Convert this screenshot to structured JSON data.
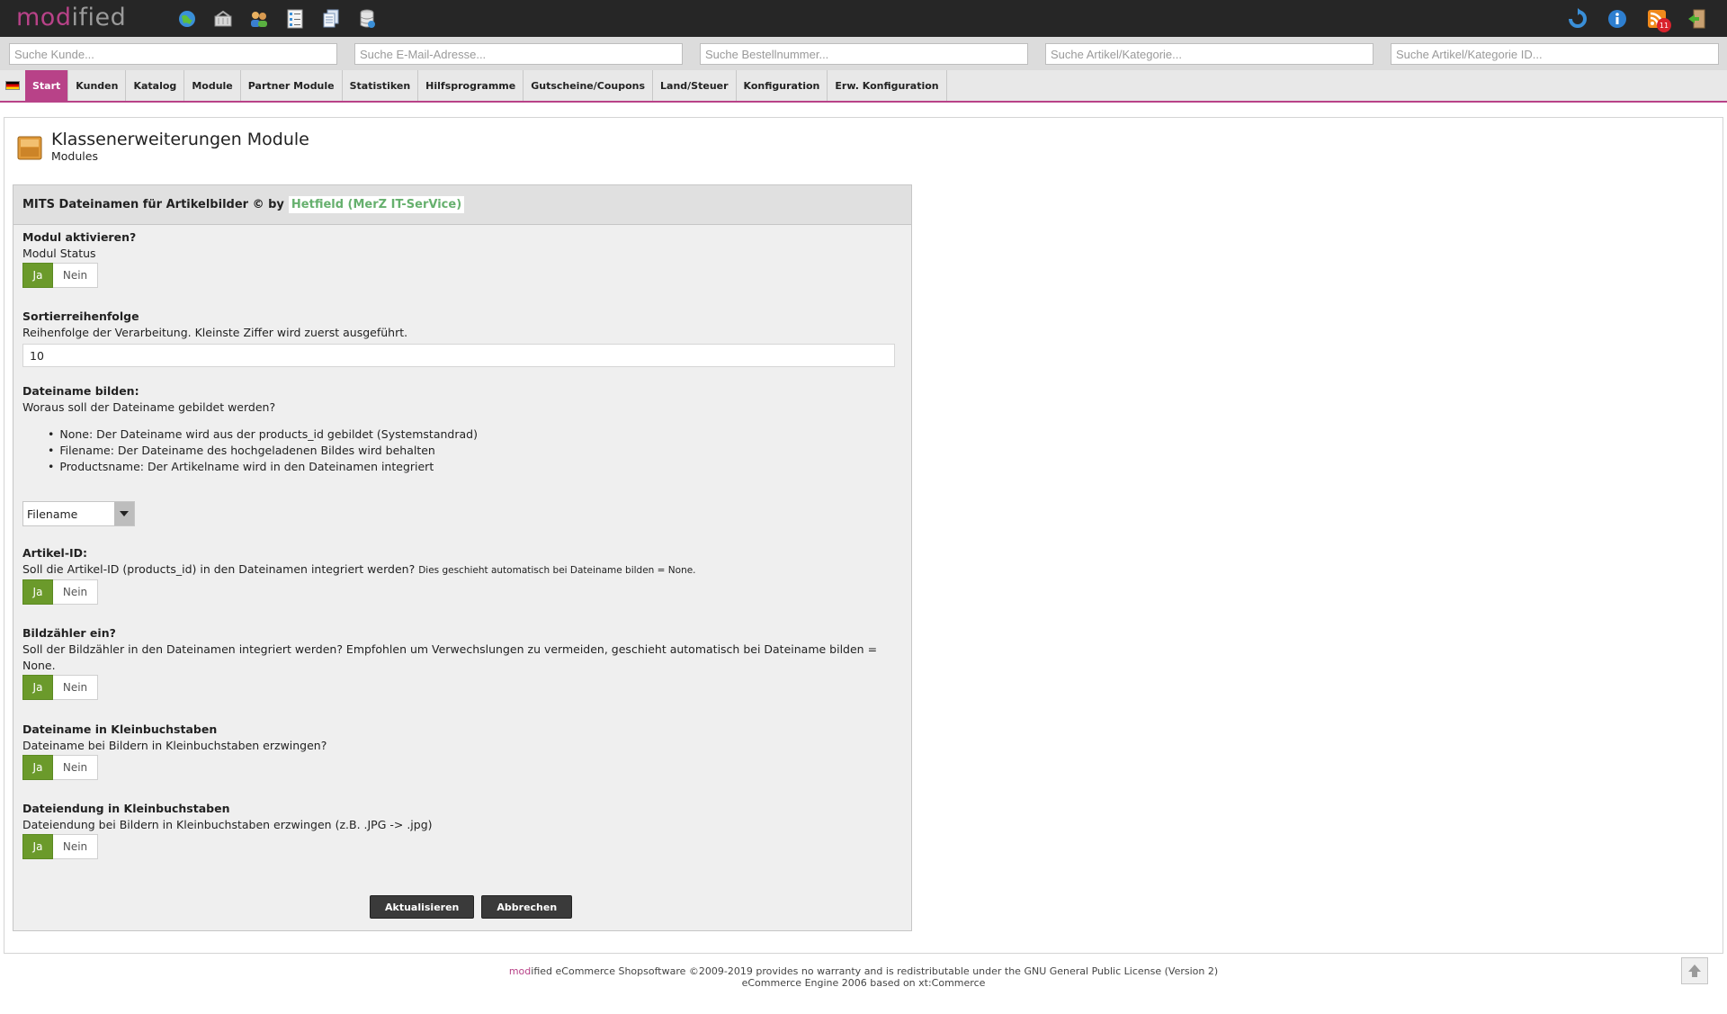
{
  "header": {
    "logo_mod": "mod",
    "logo_ified": "ified",
    "icons": [
      "globe-icon",
      "basket-icon",
      "users-icon",
      "list-icon",
      "documents-icon",
      "database-icon"
    ],
    "right_icons": [
      "refresh-icon",
      "info-icon",
      "rss-icon",
      "logout-icon"
    ],
    "rss_badge": "11"
  },
  "search": {
    "customer": "Suche Kunde...",
    "email": "Suche E-Mail-Adresse...",
    "order": "Suche Bestellnummer...",
    "article": "Suche Artikel/Kategorie...",
    "article_id": "Suche Artikel/Kategorie ID..."
  },
  "nav": [
    "Start",
    "Kunden",
    "Katalog",
    "Module",
    "Partner Module",
    "Statistiken",
    "Hilfsprogramme",
    "Gutscheine/Coupons",
    "Land/Steuer",
    "Konfiguration",
    "Erw. Konfiguration"
  ],
  "page": {
    "title": "Klassenerweiterungen Module",
    "subtitle": "Modules"
  },
  "box": {
    "title": "MITS Dateinamen für Artikelbilder © by",
    "author": "Hetfield (MerZ IT-SerVice)"
  },
  "fields": {
    "status": {
      "label": "Modul aktivieren?",
      "desc": "Modul Status"
    },
    "sort": {
      "label": "Sortierreihenfolge",
      "desc": "Reihenfolge der Verarbeitung. Kleinste Ziffer wird zuerst ausgeführt.",
      "value": "10"
    },
    "filename": {
      "label": "Dateiname bilden:",
      "desc": "Woraus soll der Dateiname gebildet werden?",
      "bullets": [
        "None: Der Dateiname wird aus der products_id gebildet (Systemstandrad)",
        "Filename: Der Dateiname des hochgeladenen Bildes wird behalten",
        "Productsname: Der Artikelname wird in den Dateinamen integriert"
      ],
      "selected": "Filename"
    },
    "article_id": {
      "label": "Artikel-ID:",
      "desc": "Soll die Artikel-ID (products_id) in den Dateinamen integriert werden?",
      "note": "Dies geschieht automatisch bei Dateiname bilden = None."
    },
    "counter": {
      "label": "Bildzähler ein?",
      "desc": "Soll der Bildzähler in den Dateinamen integriert werden? Empfohlen um Verwechslungen zu vermeiden, geschieht automatisch bei Dateiname bilden =",
      "desc2": "None."
    },
    "lower_name": {
      "label": "Dateiname in Kleinbuchstaben",
      "desc": "Dateiname bei Bildern in Kleinbuchstaben erzwingen?"
    },
    "lower_ext": {
      "label": "Dateiendung in Kleinbuchstaben",
      "desc": "Dateiendung bei Bildern in Kleinbuchstaben erzwingen (z.B. .JPG -> .jpg)"
    }
  },
  "toggle": {
    "yes": "Ja",
    "no": "Nein"
  },
  "buttons": {
    "update": "Aktualisieren",
    "cancel": "Abbrechen"
  },
  "footer": {
    "mod": "mod",
    "line1": "ified eCommerce Shopsoftware ©2009-2019 provides no warranty and is redistributable under the GNU General Public License (Version 2)",
    "line2": "eCommerce Engine 2006 based on xt:Commerce"
  },
  "colors": {
    "brand": "#b84288",
    "toggle_on": "#6b9a2b",
    "author": "#66b06e"
  }
}
